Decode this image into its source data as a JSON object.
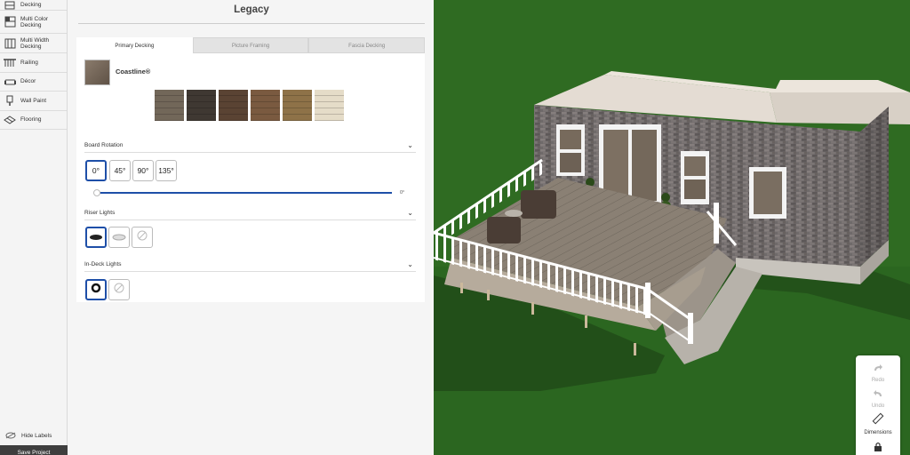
{
  "sidebar": {
    "items": [
      {
        "label": "Decking",
        "icon": "decking-icon"
      },
      {
        "label": "Multi Color Decking",
        "icon": "multi-color-decking-icon"
      },
      {
        "label": "Multi Width Decking",
        "icon": "multi-width-decking-icon"
      },
      {
        "label": "Railing",
        "icon": "railing-icon"
      },
      {
        "label": "Décor",
        "icon": "decor-icon"
      },
      {
        "label": "Wall Paint",
        "icon": "wall-paint-icon"
      },
      {
        "label": "Flooring",
        "icon": "flooring-icon"
      }
    ],
    "hide_labels": "Hide Labels",
    "save_project": "Save Project"
  },
  "panel": {
    "title": "Legacy",
    "tabs": [
      {
        "label": "Primary Decking",
        "active": true
      },
      {
        "label": "Picture Framing",
        "active": false
      },
      {
        "label": "Fascia Decking",
        "active": false
      }
    ],
    "product_name": "Coastline®",
    "swatches": [
      "#726759",
      "#3f3832",
      "#5a4333",
      "#7a5a40",
      "#8e7248",
      "#e5dcc8"
    ],
    "board_rotation": {
      "label": "Board Rotation",
      "options": [
        "0°",
        "45°",
        "90°",
        "135°"
      ],
      "selected": "0°",
      "slider_value": "0°"
    },
    "riser_lights": {
      "label": "Riser Lights",
      "options": [
        "black-light",
        "white-light",
        "none"
      ],
      "selected": "black-light"
    },
    "in_deck_lights": {
      "label": "In-Deck Lights",
      "options": [
        "black-ring-light",
        "none"
      ],
      "selected": "black-ring-light"
    }
  },
  "toolbar": {
    "redo": "Redo",
    "undo": "Undo",
    "dimensions": "Dimensions"
  },
  "colors": {
    "accent": "#1e4fa8",
    "grass": "#2f6b22"
  }
}
